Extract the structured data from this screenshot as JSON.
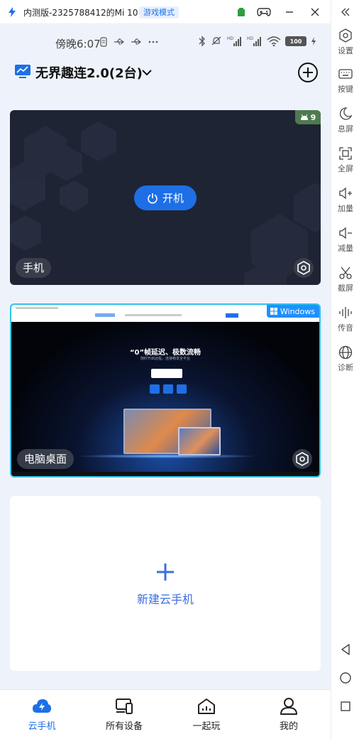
{
  "window": {
    "title": "内测版-2325788412的Mi 10",
    "mode_badge": "游戏模式"
  },
  "statusbar": {
    "time": "傍晚6:07",
    "battery": "100"
  },
  "header": {
    "title": "无界趣连2.0(2台)"
  },
  "devices": [
    {
      "label": "手机",
      "power_button": "开机",
      "badge_count": "9",
      "badge_icon": "android-icon"
    },
    {
      "label": "电脑桌面",
      "os_badge": "Windows",
      "screen_preview": {
        "hero_title": "“0”帧延迟、极数流畅",
        "hero_subtitle": "随时开启远程，连接畅享全平台"
      }
    }
  ],
  "new_device": {
    "label": "新建云手机"
  },
  "bottom_nav": [
    {
      "label": "云手机",
      "icon": "cloud-phone-icon",
      "active": true
    },
    {
      "label": "所有设备",
      "icon": "devices-icon",
      "active": false
    },
    {
      "label": "一起玩",
      "icon": "home-play-icon",
      "active": false
    },
    {
      "label": "我的",
      "icon": "user-icon",
      "active": false
    }
  ],
  "sidebar": [
    {
      "label": "设置",
      "icon": "settings-icon"
    },
    {
      "label": "按键",
      "icon": "keyboard-icon"
    },
    {
      "label": "息屏",
      "icon": "moon-icon"
    },
    {
      "label": "全屏",
      "icon": "fullscreen-icon"
    },
    {
      "label": "加量",
      "icon": "volume-up-icon"
    },
    {
      "label": "减量",
      "icon": "volume-down-icon"
    },
    {
      "label": "截屏",
      "icon": "scissors-icon"
    },
    {
      "label": "传音",
      "icon": "audio-icon"
    },
    {
      "label": "诊断",
      "icon": "globe-icon"
    }
  ],
  "colors": {
    "accent": "#1e6fe6",
    "card_dark": "#1e2434",
    "phone_bg": "#eef3fb",
    "selected_border": "#2fc3e8"
  }
}
